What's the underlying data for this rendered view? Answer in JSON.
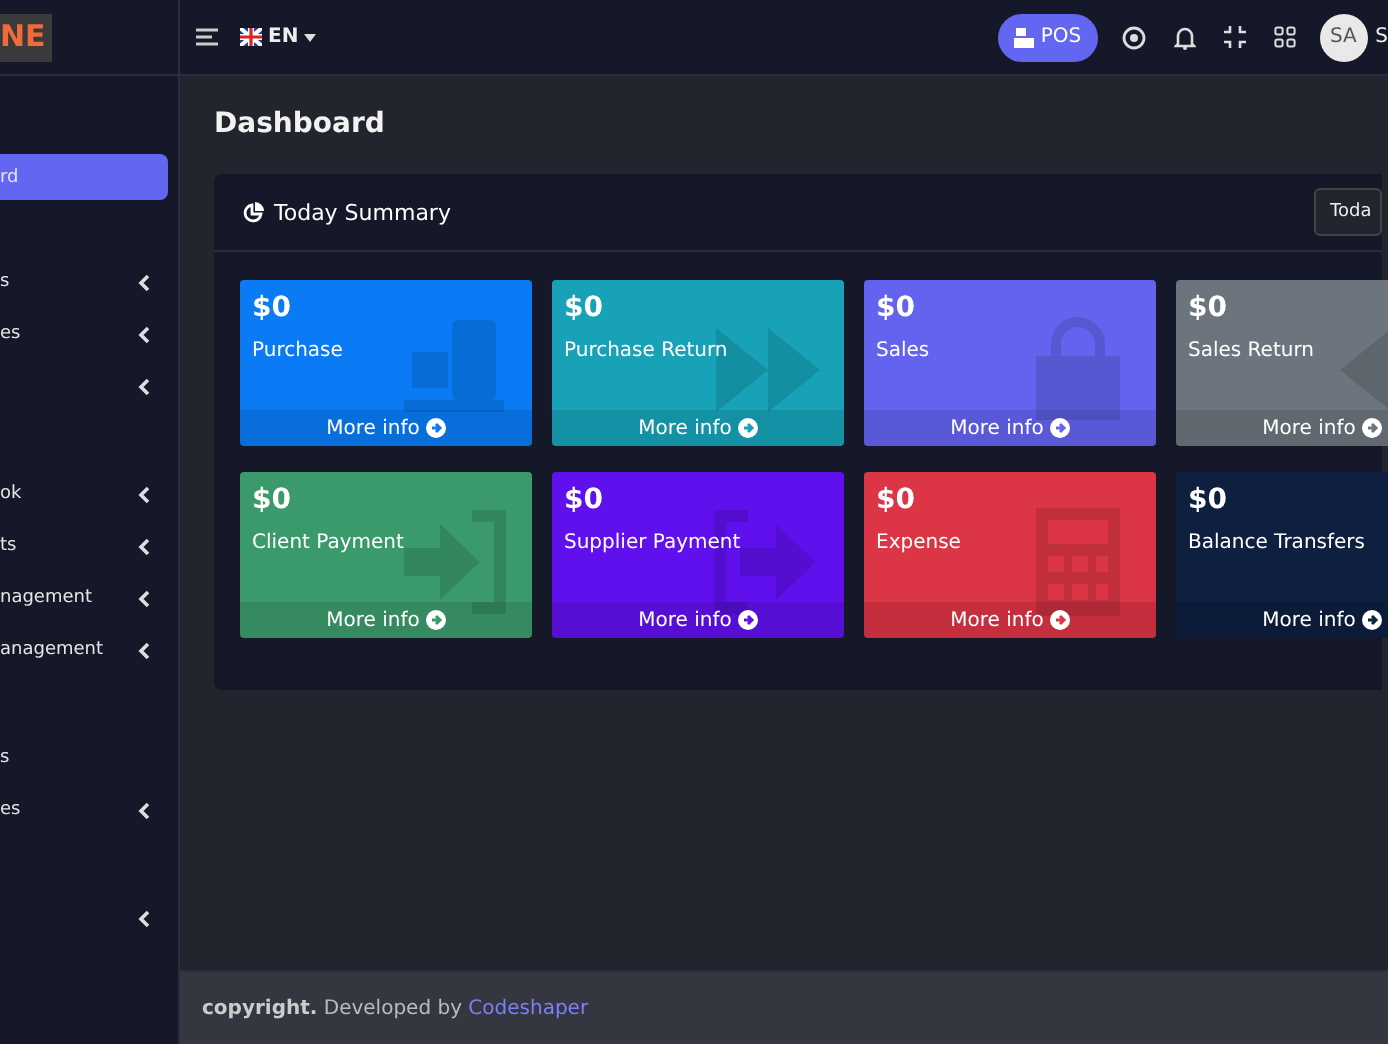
{
  "sidebar": {
    "logo": "NE",
    "groups": [
      {
        "items": [
          {
            "label": "rd",
            "selected": true,
            "expandable": false
          }
        ]
      },
      {
        "items": [
          {
            "label": "s",
            "selected": false,
            "expandable": true
          },
          {
            "label": "es",
            "selected": false,
            "expandable": true
          },
          {
            "selected": false,
            "expandable": true
          }
        ]
      },
      {
        "items": [
          {
            "label": "ok",
            "selected": false,
            "expandable": true
          },
          {
            "label": "ts",
            "selected": false,
            "expandable": true
          },
          {
            "label": "nagement",
            "selected": false,
            "expandable": true
          },
          {
            "label": "anagement",
            "selected": false,
            "expandable": true
          }
        ]
      },
      {
        "items": [
          {
            "label": "s",
            "selected": false,
            "expandable": false
          },
          {
            "label": "es",
            "selected": false,
            "expandable": true
          }
        ]
      },
      {
        "items": [
          {
            "selected": false,
            "expandable": true
          }
        ]
      }
    ]
  },
  "topbar": {
    "language": "EN",
    "pos_button": "POS",
    "avatar": "SA",
    "user_name": "S"
  },
  "page_title": "Dashboard",
  "summary": {
    "title": "Today Summary",
    "period_button": "Toda",
    "cards": [
      {
        "amount": "$0",
        "label": "Purchase",
        "link": "More info",
        "color": "#0a7bf5"
      },
      {
        "amount": "$0",
        "label": "Purchase Return",
        "link": "More info",
        "color": "#17a2b8"
      },
      {
        "amount": "$0",
        "label": "Sales",
        "link": "More info",
        "color": "#6463ef"
      },
      {
        "amount": "$0",
        "label": "Sales Return",
        "link": "More info",
        "color": "#6c757d"
      },
      {
        "amount": "$0",
        "label": "Client Payment",
        "link": "More info",
        "color": "#3b9a6b"
      },
      {
        "amount": "$0",
        "label": "Supplier Payment",
        "link": "More info",
        "color": "#6010ec"
      },
      {
        "amount": "$0",
        "label": "Expense",
        "link": "More info",
        "color": "#dc3545"
      },
      {
        "amount": "$0",
        "label": "Balance Transfers",
        "link": "More info",
        "color": "#0e1f3f"
      }
    ]
  },
  "footer": {
    "copyright": "copyright.",
    "text": "Developed by",
    "link": "Codeshaper"
  }
}
